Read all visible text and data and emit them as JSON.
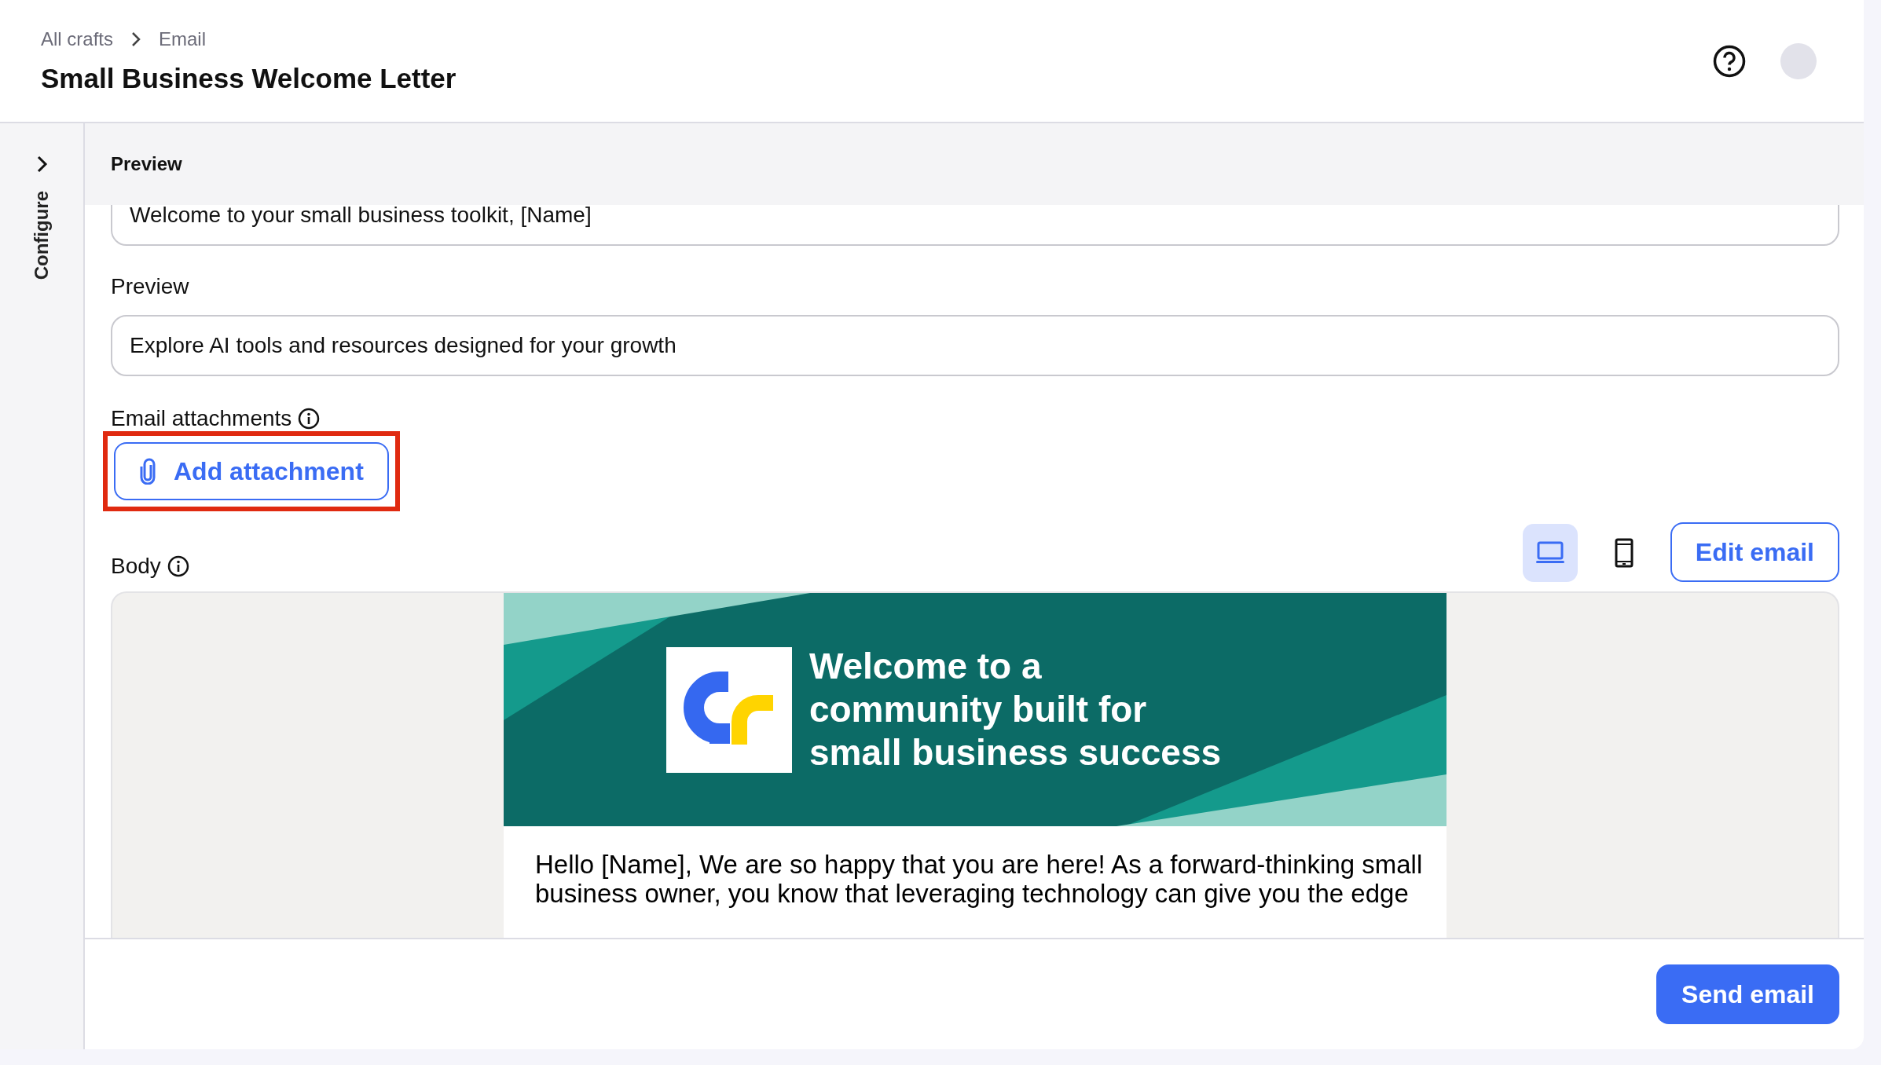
{
  "breadcrumb": [
    {
      "label": "All crafts"
    },
    {
      "label": "Email"
    }
  ],
  "title": "Small Business Welcome Letter",
  "sidebar": {
    "label": "Configure",
    "expanded": false
  },
  "section_header": "Preview",
  "subject_field": {
    "value": "Welcome to your small business toolkit, [Name]"
  },
  "preview_field": {
    "label": "Preview",
    "value": "Explore AI tools and resources designed for your growth"
  },
  "attachments": {
    "label": "Email attachments",
    "button": "Add attachment",
    "highlighted": true
  },
  "body": {
    "label": "Body",
    "view_modes": [
      {
        "kind": "desktop",
        "selected": true
      },
      {
        "kind": "mobile",
        "selected": false
      }
    ],
    "edit_button": "Edit email",
    "email": {
      "heading_lines": [
        "Welcome to a",
        "community built for",
        "small business success"
      ],
      "text": "Hello [Name], We are so happy that you are here! As a forward-thinking small business owner, you know that leveraging technology can give you the edge"
    }
  },
  "send_button": "Send email"
}
